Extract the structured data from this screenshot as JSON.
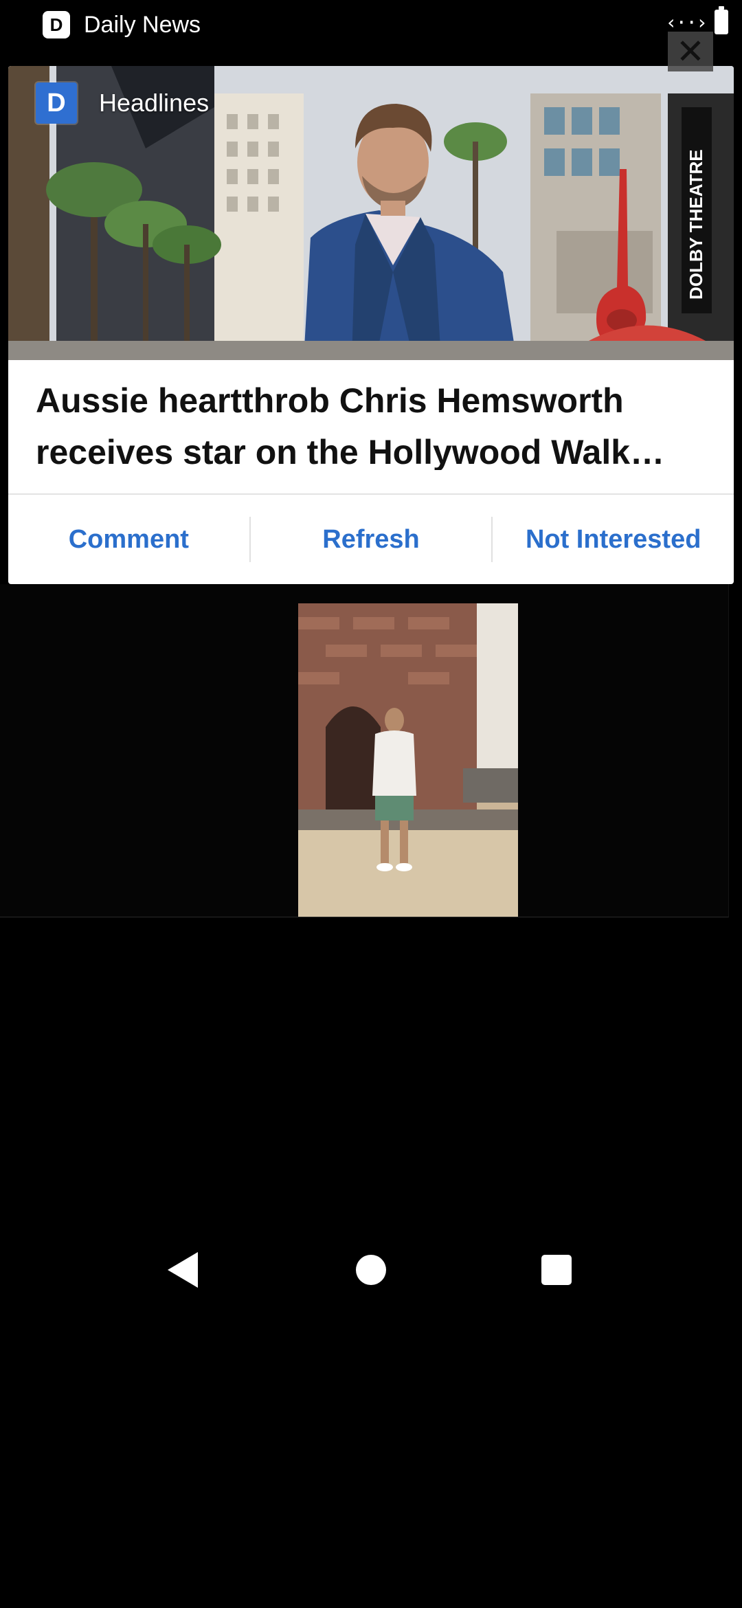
{
  "status_bar": {
    "app_icon_letter": "D",
    "app_name": "Daily News"
  },
  "card": {
    "brand_logo_letter": "D",
    "section_label": "Headlines",
    "headline": "Aussie heartthrob Chris Hemsworth receives star on the Hollywood Walk…",
    "hero_sign_text": "DOLBY THEATRE",
    "actions": {
      "comment": "Comment",
      "refresh": "Refresh",
      "not_interested": "Not Interested"
    }
  },
  "close_glyph": "✕",
  "colors": {
    "accent": "#2b6fcc",
    "brand": "#2f6fd1",
    "background": "#000000"
  },
  "icons": [
    "data-transfer-icon",
    "battery-icon",
    "close-icon",
    "back-icon",
    "home-icon",
    "recents-icon"
  ]
}
